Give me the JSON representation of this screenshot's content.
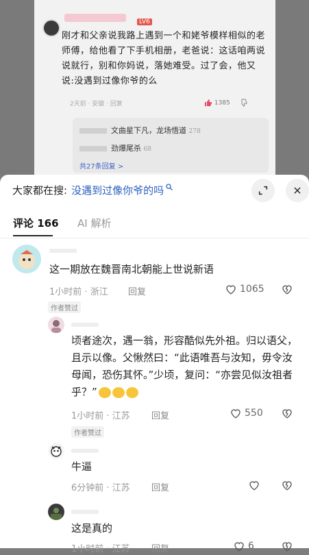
{
  "background_post": {
    "level_badge": "LV6",
    "text": "刚才和父亲说我路上遇到一个和姥爷模样相似的老师傅，给他看了下手机相册，老爸说：这话咱两说说就行，别和你妈说，落她难受。过了会，他又说:没遇到过像你爷的么",
    "meta": "2天前 · 安徽 · 回复",
    "likes": "1385",
    "sub_replies": [
      {
        "text": "文曲星下凡，龙场悟道",
        "likes": "278"
      },
      {
        "text": "劲爆尾杀",
        "likes": "68"
      }
    ],
    "more_replies": "共27条回复 >"
  },
  "search": {
    "label": "大家都在搜:",
    "query": "没遇到过像你爷的吗"
  },
  "tabs": {
    "comments": "评论 166",
    "ai": "AI 解析"
  },
  "comments": [
    {
      "text": "这一期放在魏晋南北朝能上世说新语",
      "time": "1小时前 · 浙江",
      "reply": "回复",
      "likes": "1065",
      "author_tag": "作者赞过"
    },
    {
      "text": "顷者途次，遇一翁，形容酷似先外祖。归以语父，且示以像。父愀然曰：“此语唯吾与汝知，毋令汝母闻，恐伤其怀。”少顷，复问：“亦尝见似汝祖者乎？”",
      "time": "1小时前 · 江苏",
      "reply": "回复",
      "likes": "550",
      "author_tag": "作者赞过"
    },
    {
      "text": "牛逼",
      "time": "6分钟前 · 江苏",
      "reply": "回复",
      "likes": ""
    },
    {
      "text": "这是真的",
      "time": "1小时前 · 江苏",
      "reply": "回复",
      "likes": "6"
    }
  ]
}
